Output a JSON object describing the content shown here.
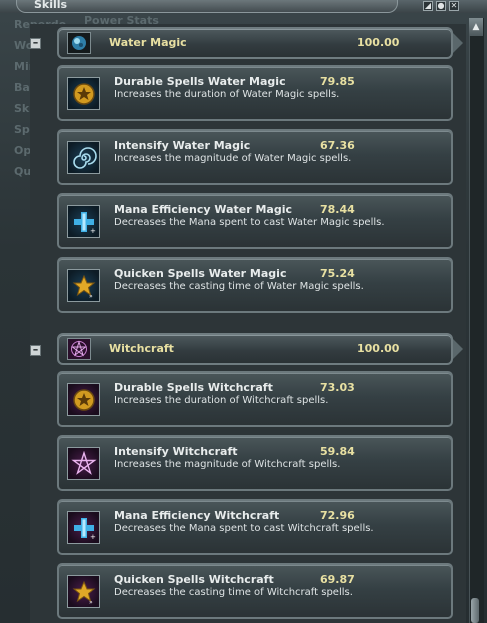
{
  "window": {
    "title": "Skills"
  },
  "background_window": {
    "items": [
      "Reperdo",
      "Wo",
      "Minin",
      "Backp",
      "Skill",
      "Spell",
      "Optio",
      "Quit"
    ],
    "tab": "Power Stats"
  },
  "categories": [
    {
      "name": "Water Magic",
      "value": "100.00",
      "icon": "water-orb-icon",
      "skills": [
        {
          "name": "Durable Spells Water Magic",
          "value": "79.85",
          "desc": "Increases the duration of Water Magic spells.",
          "icon": "durable-spells-icon"
        },
        {
          "name": "Intensify Water Magic",
          "value": "67.36",
          "desc": "Increases the magnitude of Water Magic spells.",
          "icon": "intensify-spiral-icon"
        },
        {
          "name": "Mana Efficiency Water Magic",
          "value": "78.44",
          "desc": "Decreases the Mana spent to cast Water Magic spells.",
          "icon": "mana-efficiency-icon"
        },
        {
          "name": "Quicken Spells Water Magic",
          "value": "75.24",
          "desc": "Decreases the casting time of Water Magic spells.",
          "icon": "quicken-spells-icon"
        }
      ]
    },
    {
      "name": "Witchcraft",
      "value": "100.00",
      "icon": "pentagram-icon",
      "skills": [
        {
          "name": "Durable Spells Witchcraft",
          "value": "73.03",
          "desc": "Increases the duration of Witchcraft spells.",
          "icon": "durable-spells-icon"
        },
        {
          "name": "Intensify Witchcraft",
          "value": "59.84",
          "desc": "Increases the magnitude of Witchcraft spells.",
          "icon": "intensify-pentagram-icon"
        },
        {
          "name": "Mana Efficiency Witchcraft",
          "value": "72.96",
          "desc": "Decreases the Mana spent to cast Witchcraft spells.",
          "icon": "mana-efficiency-icon"
        },
        {
          "name": "Quicken Spells Witchcraft",
          "value": "69.87",
          "desc": "Decreases the casting time of Witchcraft spells.",
          "icon": "quicken-spells-icon"
        }
      ]
    }
  ],
  "colors": {
    "value": "#e8e0a2",
    "water": "#1b3e55",
    "witch": "#4a1d4b",
    "frame": "#6c797d"
  }
}
